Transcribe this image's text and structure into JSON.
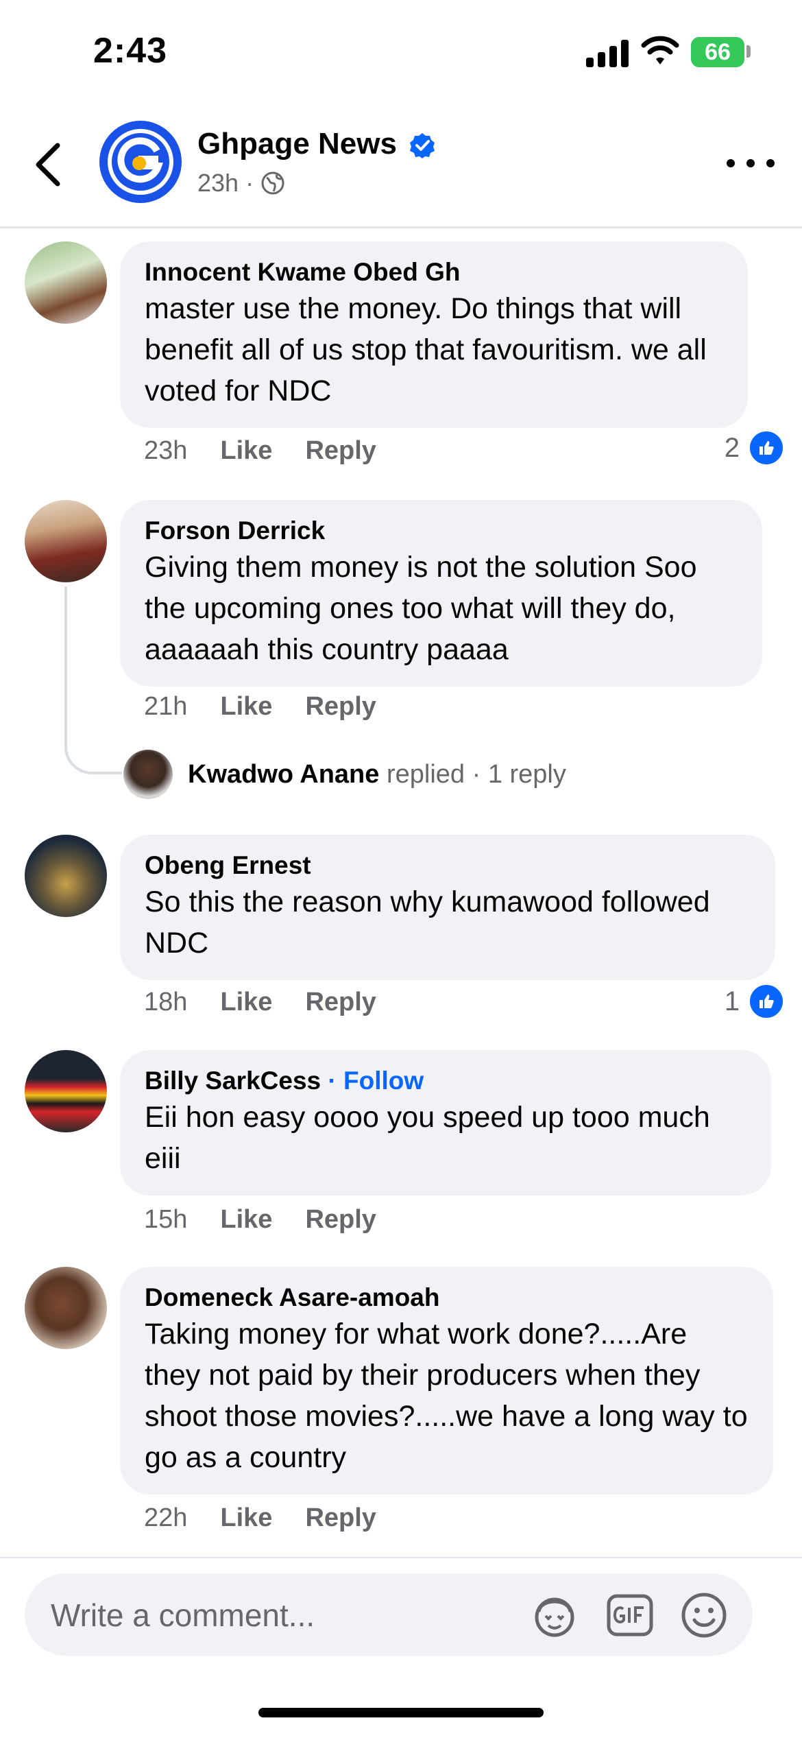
{
  "status_bar": {
    "time": "2:43",
    "battery": "66"
  },
  "header": {
    "page_name": "Ghpage News",
    "post_time": "23h",
    "separator": "·"
  },
  "comments": [
    {
      "author": "Innocent Kwame Obed Gh",
      "text": "master use the money. Do things that will benefit all of us stop that favouritism. we all voted for NDC",
      "time": "23h",
      "like_label": "Like",
      "reply_label": "Reply",
      "reaction_count": "2"
    },
    {
      "author": "Forson Derrick",
      "text": "Giving them money is not the solution Soo the upcoming ones too what will they do, aaaaaah this country paaaa",
      "time": "21h",
      "like_label": "Like",
      "reply_label": "Reply"
    },
    {
      "author": "Obeng Ernest",
      "text": "So this the reason why kumawood followed NDC",
      "time": "18h",
      "like_label": "Like",
      "reply_label": "Reply",
      "reaction_count": "1"
    },
    {
      "author": "Billy SarkCess",
      "follow_label": "Follow",
      "text": "Eii hon easy oooo you speed up tooo much eiii",
      "time": "15h",
      "like_label": "Like",
      "reply_label": "Reply"
    },
    {
      "author": "Domeneck Asare-amoah",
      "text": "Taking money for what work done?.....Are they not paid by their producers when they shoot those movies?.....we have a long way to go as a country",
      "time": "22h",
      "like_label": "Like",
      "reply_label": "Reply"
    }
  ],
  "reply_thread": {
    "name": "Kwadwo Anane",
    "action": "replied",
    "count_text": "· 1 reply"
  },
  "composer": {
    "placeholder": "Write a comment..."
  },
  "colors": {
    "accent": "#0866ff",
    "bubble": "#f0f2f5",
    "muted": "#65676b",
    "battery": "#34c759"
  },
  "icons": [
    "back-arrow-icon",
    "verified-badge-icon",
    "globe-icon",
    "more-options-icon",
    "like-thumb-icon",
    "avatar-sticker-icon",
    "gif-icon",
    "emoji-icon"
  ]
}
